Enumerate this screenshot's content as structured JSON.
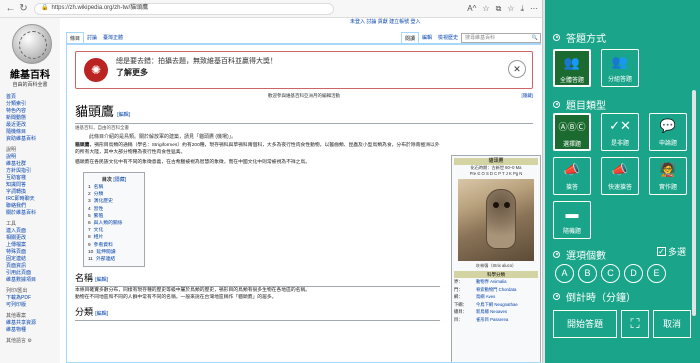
{
  "browser": {
    "url": "https://zh.wikipedia.org/zh-tw/貓頭鷹",
    "toolbar_icons": [
      "A^",
      "☆",
      "⧉",
      "☆",
      "⤓",
      "⋯"
    ]
  },
  "wiki": {
    "logo_title": "維基百科",
    "logo_subtitle": "自由的百科全書",
    "sidebar_main": [
      "首頁",
      "分類索引",
      "特色內容",
      "新聞動態",
      "最近更改",
      "隨機條目",
      "資助維基百科"
    ],
    "sidebar_help_head": "說明",
    "sidebar_help": [
      "說明",
      "維基社群",
      "方針與指引",
      "互助客棧",
      "知識問答",
      "字詞轉換",
      "IRC即時聊天",
      "聯絡我們",
      "關於維基百科"
    ],
    "sidebar_tools_head": "工具",
    "sidebar_tools": [
      "連入頁面",
      "相關更改",
      "上傳檔案",
      "特殊頁面",
      "固定連結",
      "頁面資訊",
      "引用此頁面",
      "維基數據項目"
    ],
    "sidebar_print_head": "列印/匯出",
    "sidebar_print": [
      "下載為PDF",
      "可列印版"
    ],
    "sidebar_other_head": "其他專案",
    "sidebar_other": [
      "維基共享資源",
      "維基物種"
    ],
    "sidebar_lang_head": "其他語言",
    "top_right": "未登入  討論  貢獻  建立帳號  登入",
    "tabs": {
      "page": "條目",
      "talk": "討論",
      "variant": "臺灣正體",
      "read": "閱讀",
      "edit": "編輯",
      "history": "檢視歷史"
    },
    "search_placeholder": "搜尋維基百科",
    "banner_text": "總是要去錯：拍攝去題，無致維基百科並贏得大獎！",
    "banner_more": "了解更多",
    "notice": "歡迎參與維基百科亞洲月的編輯活動",
    "notice_right": "[隱藏]",
    "title": "貓頭鷹",
    "title_edit": "[編輯]",
    "from_line": "維基百科，自由的百科全書",
    "hatnote": "此條目介紹的是鳥類。關於解放軍的建築，請見「貓頭鷹 (機場)」。",
    "para1_lead": "貓頭鷹",
    "para1": "，鴞形目鳥類的通稱（學名：Strigiformes）約有200種，現存鴞科與草鴞科兩個科，大多為夜行性肉食性動物，以齧齒類、昆蟲及小型鳥類為食，分布於除南極洲以外的所有大陸，其中大部分物種為夜行性肉食性猛禽。",
    "para2": "貓頭鷹在各民族文化中有不同的象徵意義，在古希臘被視為智慧的象徵，而在中國文化中則常被視為不祥之鳥。",
    "toc_title": "目次",
    "toc_toggle": "[隱藏]",
    "toc": [
      {
        "n": "1",
        "t": "名稱"
      },
      {
        "n": "2",
        "t": "分類"
      },
      {
        "n": "3",
        "t": "演化歷史"
      },
      {
        "n": "4",
        "t": "習性"
      },
      {
        "n": "5",
        "t": "繁殖"
      },
      {
        "n": "6",
        "t": "與人類的關係"
      },
      {
        "n": "7",
        "t": "文化"
      },
      {
        "n": "8",
        "t": "相片"
      },
      {
        "n": "9",
        "t": "參看資料"
      },
      {
        "n": "10",
        "t": "延伸閱讀"
      },
      {
        "n": "11",
        "t": "外部連結"
      }
    ],
    "h_name": "名稱",
    "h_name_edit": "[編輯]",
    "para3": "本條目確實多數分布，同樣有現存種的歷史等級中屬於鳥類的歷史，鴞形目的鳥類有很多生物在各地區的名稱。",
    "para4": "動物在不同地區和不同的人群中常有不同的名稱，一般來說在台灣地區稱作「貓頭鷹」的居多。",
    "h_class": "分類",
    "h_class_edit": "[編輯]",
    "infobox": {
      "title": "貓頭鷹",
      "status": "化石時期：古新世 60–0 Ma",
      "status2": "Pre  Є  O  S  D  C  P  T  J  K  Pg  N",
      "caption": "灰林鴞（Strix aluco）",
      "class_head": "科學分類",
      "rows": [
        {
          "k": "界：",
          "v": "動物界 Animalia"
        },
        {
          "k": "門：",
          "v": "脊索動物門 Chordata"
        },
        {
          "k": "綱：",
          "v": "鳥綱 Aves"
        },
        {
          "k": "下綱：",
          "v": "今鳥下綱 Neognathae"
        },
        {
          "k": "總目：",
          "v": "新鳥總 Neoaves"
        },
        {
          "k": "目：",
          "v": "雀形目 Passerea"
        }
      ]
    }
  },
  "panel": {
    "section_answer_mode": "答題方式",
    "tiles_mode": [
      {
        "label": "全體答題",
        "icon": "👥"
      },
      {
        "label": "分組答題",
        "icon": "👥"
      }
    ],
    "section_type": "題目類型",
    "tiles_type": [
      {
        "label": "選擇題",
        "icon": "ⒶⒷⒸ"
      },
      {
        "label": "是非題",
        "icon": "✓✕"
      },
      {
        "label": "申論題",
        "icon": "💬"
      },
      {
        "label": "搶答",
        "icon": "📣"
      },
      {
        "label": "快速搶答",
        "icon": "📣"
      },
      {
        "label": "實作題",
        "icon": "🧑‍🏫"
      },
      {
        "label": "隨機題",
        "icon": "▬"
      }
    ],
    "section_options": "選項個數",
    "multi_label": "多選",
    "options": [
      "A",
      "B",
      "C",
      "D",
      "E"
    ],
    "section_timer": "倒計時（分鐘）",
    "start_label": "開始答題",
    "crop_icon": "⛶",
    "cancel_label": "取消",
    "accent": "#1aa58a",
    "selected": "#1b6b31"
  }
}
